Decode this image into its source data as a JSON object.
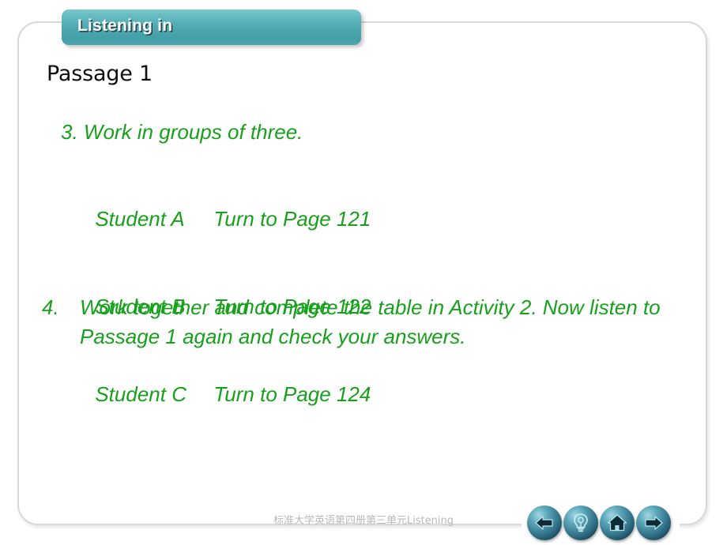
{
  "slide": {
    "banner": {
      "label": "Listening in",
      "color": "#4fa7b0"
    },
    "title": "Passage 1",
    "accent_green": "#17a01b",
    "activities": [
      {
        "number": "3.",
        "text": "Work in groups of three."
      },
      {
        "number": "4.",
        "text": "Work together and complete the table in Activity 2. Now listen to Passage 1 again and check your answers."
      }
    ],
    "student_assignments": [
      {
        "student": "Student A",
        "instruction": "Turn to Page 121"
      },
      {
        "student": "Student B",
        "instruction": "Turn to Page 122"
      },
      {
        "student": "Student C",
        "instruction": "Turn to Page 124"
      }
    ]
  },
  "footer": {
    "text": "标准大学英语第四册第三单元Listening",
    "nav_buttons": [
      {
        "name": "previous",
        "icon": "back-arrow-icon"
      },
      {
        "name": "hint",
        "icon": "lightbulb-icon"
      },
      {
        "name": "home",
        "icon": "home-icon"
      },
      {
        "name": "next",
        "icon": "forward-arrow-icon"
      }
    ]
  }
}
